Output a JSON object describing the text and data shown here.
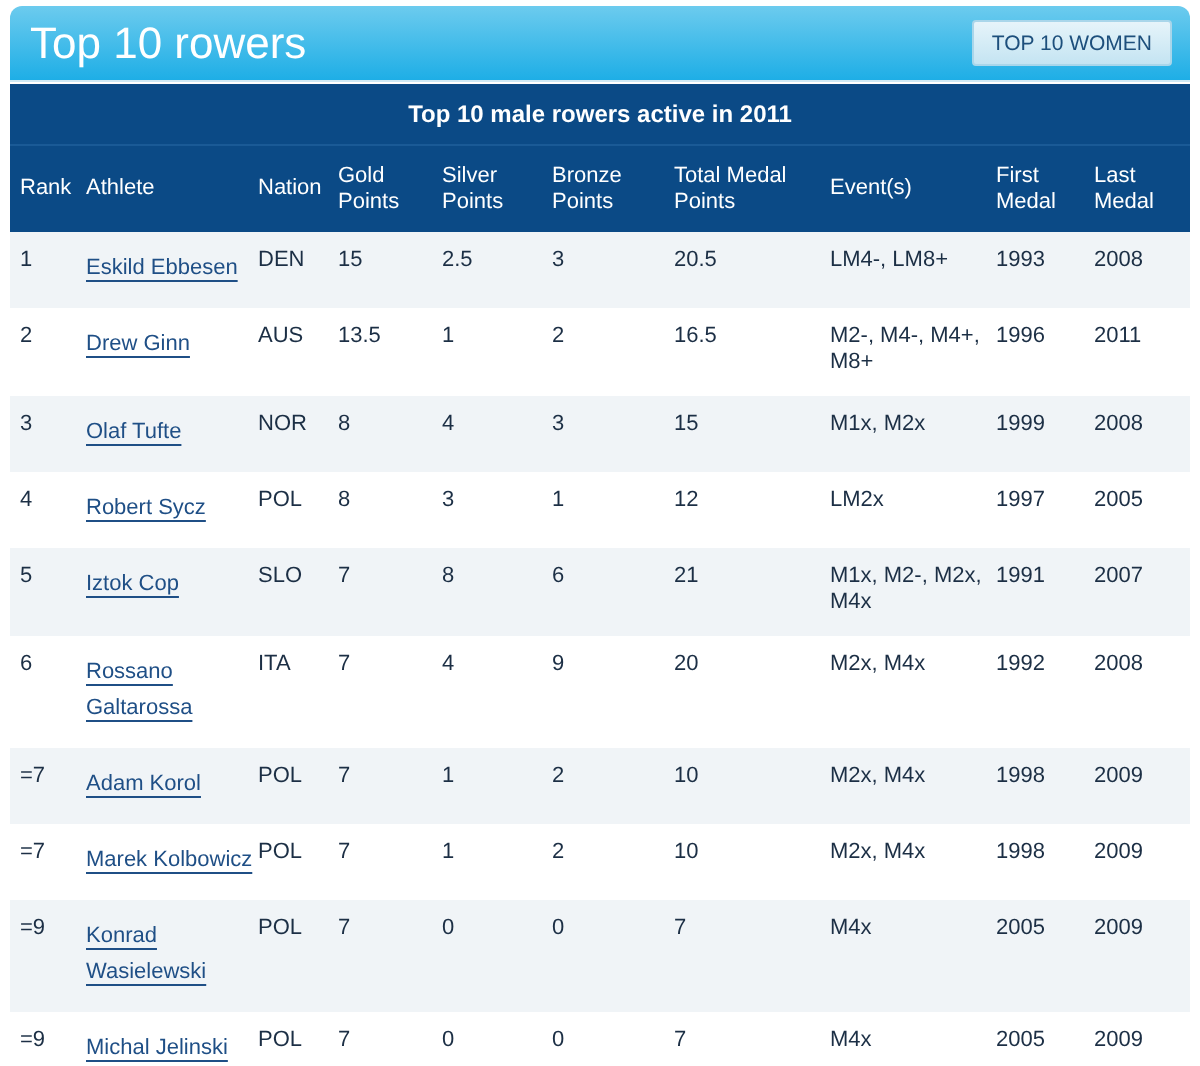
{
  "header": {
    "title": "Top 10 rowers",
    "button": "TOP 10 WOMEN"
  },
  "table": {
    "caption": "Top 10 male rowers active in 2011",
    "columns": [
      "Rank",
      "Athlete",
      "Nation",
      "Gold Points",
      "Silver Points",
      "Bronze Points",
      "Total Medal Points",
      "Event(s)",
      "First Medal",
      "Last Medal"
    ],
    "rows": [
      {
        "rank": "1",
        "athlete": "Eskild Ebbesen",
        "nation": "DEN",
        "gold": "15",
        "silver": "2.5",
        "bronze": "3",
        "total": "20.5",
        "events": "LM4-, LM8+",
        "first": "1993",
        "last": "2008"
      },
      {
        "rank": "2",
        "athlete": "Drew Ginn",
        "nation": "AUS",
        "gold": "13.5",
        "silver": "1",
        "bronze": "2",
        "total": "16.5",
        "events": "M2-, M4-, M4+, M8+",
        "first": "1996",
        "last": "2011"
      },
      {
        "rank": "3",
        "athlete": "Olaf Tufte",
        "nation": "NOR",
        "gold": "8",
        "silver": "4",
        "bronze": "3",
        "total": "15",
        "events": "M1x, M2x",
        "first": "1999",
        "last": "2008"
      },
      {
        "rank": "4",
        "athlete": "Robert Sycz",
        "nation": "POL",
        "gold": "8",
        "silver": "3",
        "bronze": "1",
        "total": "12",
        "events": "LM2x",
        "first": "1997",
        "last": "2005"
      },
      {
        "rank": "5",
        "athlete": "Iztok Cop",
        "nation": "SLO",
        "gold": "7",
        "silver": "8",
        "bronze": "6",
        "total": "21",
        "events": "M1x, M2-, M2x, M4x",
        "first": "1991",
        "last": "2007"
      },
      {
        "rank": "6",
        "athlete": "Rossano Galtarossa",
        "nation": "ITA",
        "gold": "7",
        "silver": "4",
        "bronze": "9",
        "total": "20",
        "events": "M2x, M4x",
        "first": "1992",
        "last": "2008"
      },
      {
        "rank": "=7",
        "athlete": "Adam Korol",
        "nation": "POL",
        "gold": "7",
        "silver": "1",
        "bronze": "2",
        "total": "10",
        "events": "M2x, M4x",
        "first": "1998",
        "last": "2009"
      },
      {
        "rank": "=7",
        "athlete": "Marek Kolbowicz",
        "nation": "POL",
        "gold": "7",
        "silver": "1",
        "bronze": "2",
        "total": "10",
        "events": "M2x, M4x",
        "first": "1998",
        "last": "2009"
      },
      {
        "rank": "=9",
        "athlete": "Konrad Wasielewski",
        "nation": "POL",
        "gold": "7",
        "silver": "0",
        "bronze": "0",
        "total": "7",
        "events": "M4x",
        "first": "2005",
        "last": "2009"
      },
      {
        "rank": "=9",
        "athlete": "Michal Jelinski",
        "nation": "POL",
        "gold": "7",
        "silver": "0",
        "bronze": "0",
        "total": "7",
        "events": "M4x",
        "first": "2005",
        "last": "2009"
      }
    ]
  }
}
